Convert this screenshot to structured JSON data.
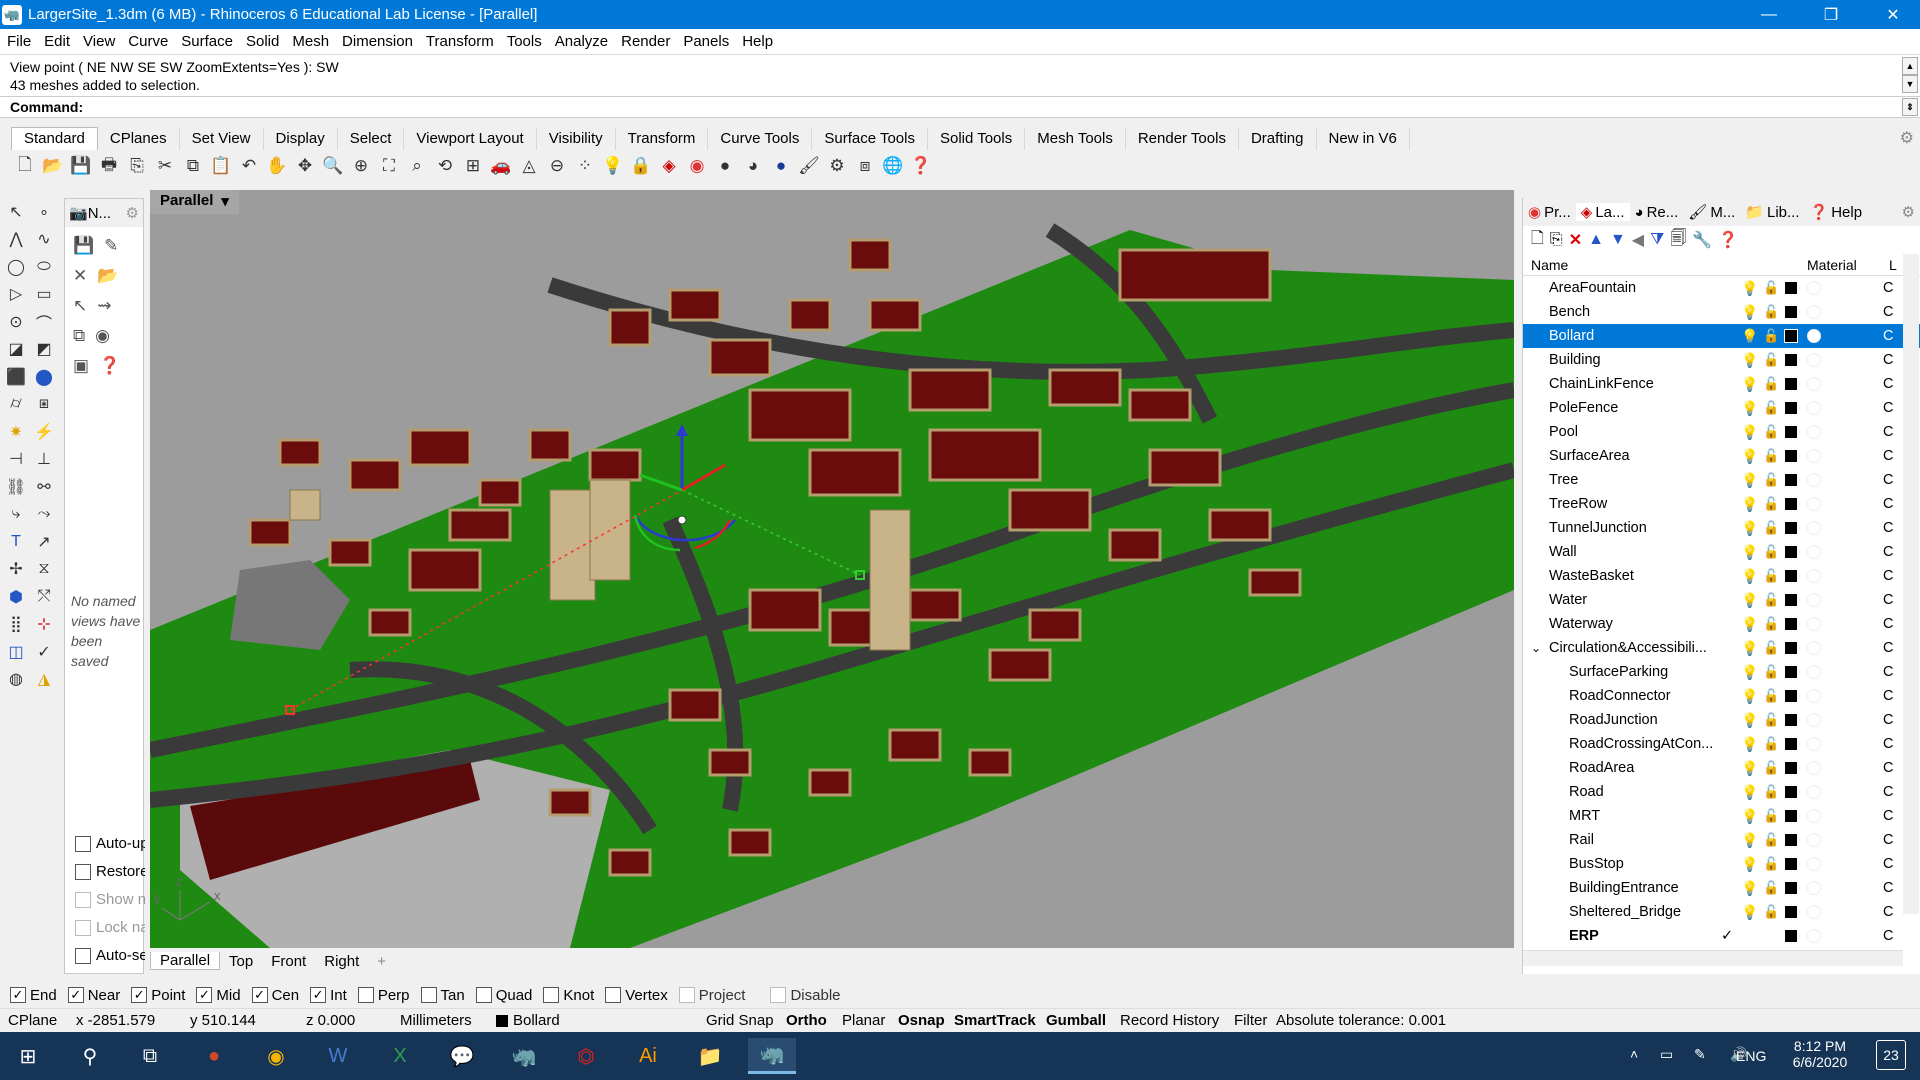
{
  "window": {
    "title": "LargerSite_1.3dm (6 MB) - Rhinoceros 6 Educational Lab License - [Parallel]"
  },
  "menu": [
    "File",
    "Edit",
    "View",
    "Curve",
    "Surface",
    "Solid",
    "Mesh",
    "Dimension",
    "Transform",
    "Tools",
    "Analyze",
    "Render",
    "Panels",
    "Help"
  ],
  "command": {
    "history_1": "View point ( NE  NW  SE  SW  ZoomExtents=Yes ): SW",
    "history_2": "43 meshes added to selection.",
    "prompt": "Command:"
  },
  "toolbar_tabs": [
    "Standard",
    "CPlanes",
    "Set View",
    "Display",
    "Select",
    "Viewport Layout",
    "Visibility",
    "Transform",
    "Curve Tools",
    "Surface Tools",
    "Solid Tools",
    "Mesh Tools",
    "Render Tools",
    "Drafting",
    "New in V6"
  ],
  "named_views": {
    "header": "N...",
    "empty_message": "No named views have been saved",
    "options": [
      {
        "label": "Auto-up",
        "enabled": true
      },
      {
        "label": "Restore",
        "enabled": true
      },
      {
        "label": "Show n",
        "enabled": false
      },
      {
        "label": "Lock na",
        "enabled": false
      },
      {
        "label": "Auto-se",
        "enabled": true
      }
    ]
  },
  "viewport": {
    "title": "Parallel",
    "dropdown": "▾",
    "tabs": [
      "Parallel",
      "Top",
      "Front",
      "Right"
    ],
    "add_tab": "+",
    "axis_x": "x",
    "axis_y": "y",
    "axis_z": "z"
  },
  "right_panel": {
    "tabs": [
      "Pr...",
      "La...",
      "Re...",
      "M...",
      "Lib...",
      "Help"
    ],
    "columns": {
      "name": "Name",
      "material": "Material",
      "linetype": "L"
    },
    "layers": [
      {
        "name": "AreaFountain",
        "indent": 1,
        "lt": "C"
      },
      {
        "name": "Bench",
        "indent": 1,
        "lt": "C"
      },
      {
        "name": "Bollard",
        "indent": 1,
        "lt": "C",
        "selected": true
      },
      {
        "name": "Building",
        "indent": 1,
        "lt": "C"
      },
      {
        "name": "ChainLinkFence",
        "indent": 1,
        "lt": "C"
      },
      {
        "name": "PoleFence",
        "indent": 1,
        "lt": "C"
      },
      {
        "name": "Pool",
        "indent": 1,
        "lt": "C"
      },
      {
        "name": "SurfaceArea",
        "indent": 1,
        "lt": "C"
      },
      {
        "name": "Tree",
        "indent": 1,
        "lt": "C"
      },
      {
        "name": "TreeRow",
        "indent": 1,
        "lt": "C"
      },
      {
        "name": "TunnelJunction",
        "indent": 1,
        "lt": "C"
      },
      {
        "name": "Wall",
        "indent": 1,
        "lt": "C"
      },
      {
        "name": "WasteBasket",
        "indent": 1,
        "lt": "C"
      },
      {
        "name": "Water",
        "indent": 1,
        "lt": "C"
      },
      {
        "name": "Waterway",
        "indent": 1,
        "lt": "C"
      },
      {
        "name": "Circulation&Accessibili...",
        "indent": 1,
        "lt": "C",
        "expander": "⌄"
      },
      {
        "name": "SurfaceParking",
        "indent": 2,
        "lt": "C"
      },
      {
        "name": "RoadConnector",
        "indent": 2,
        "lt": "C"
      },
      {
        "name": "RoadJunction",
        "indent": 2,
        "lt": "C"
      },
      {
        "name": "RoadCrossingAtCon...",
        "indent": 2,
        "lt": "C"
      },
      {
        "name": "RoadArea",
        "indent": 2,
        "lt": "C"
      },
      {
        "name": "Road",
        "indent": 2,
        "lt": "C"
      },
      {
        "name": "MRT",
        "indent": 2,
        "lt": "C"
      },
      {
        "name": "Rail",
        "indent": 2,
        "lt": "C"
      },
      {
        "name": "BusStop",
        "indent": 2,
        "lt": "C"
      },
      {
        "name": "BuildingEntrance",
        "indent": 2,
        "lt": "C"
      },
      {
        "name": "Sheltered_Bridge",
        "indent": 2,
        "lt": "C"
      },
      {
        "name": "ERP",
        "indent": 2,
        "lt": "C",
        "current": true,
        "check": "✓"
      }
    ]
  },
  "osnap": [
    {
      "label": "End",
      "checked": true
    },
    {
      "label": "Near",
      "checked": true
    },
    {
      "label": "Point",
      "checked": true
    },
    {
      "label": "Mid",
      "checked": true
    },
    {
      "label": "Cen",
      "checked": true
    },
    {
      "label": "Int",
      "checked": true
    },
    {
      "label": "Perp",
      "checked": false
    },
    {
      "label": "Tan",
      "checked": false
    },
    {
      "label": "Quad",
      "checked": false
    },
    {
      "label": "Knot",
      "checked": false
    },
    {
      "label": "Vertex",
      "checked": false
    },
    {
      "label": "Project",
      "checked": false,
      "disabled": true
    },
    {
      "label": "Disable",
      "checked": false,
      "disabled": true
    }
  ],
  "status": {
    "cplane": "CPlane",
    "x": "x -2851.579",
    "y": "y 510.144",
    "z": "z 0.000",
    "units": "Millimeters",
    "layer": "Bollard",
    "grid_snap": "Grid Snap",
    "ortho": "Ortho",
    "planar": "Planar",
    "osnap": "Osnap",
    "smarttrack": "SmartTrack",
    "gumball": "Gumball",
    "record_history": "Record History",
    "filter": "Filter",
    "tolerance": "Absolute tolerance: 0.001"
  },
  "taskbar": {
    "time": "8:12 PM",
    "date": "6/6/2020",
    "lang": "ENG",
    "notifications": "23"
  },
  "colors": {
    "accent": "#0078d7",
    "ground": "#1f8a12",
    "building": "#6b0c0c",
    "building_side": "#b59c6e",
    "road": "#3c3c3c",
    "viewport_bg": "#9c9c9c"
  }
}
